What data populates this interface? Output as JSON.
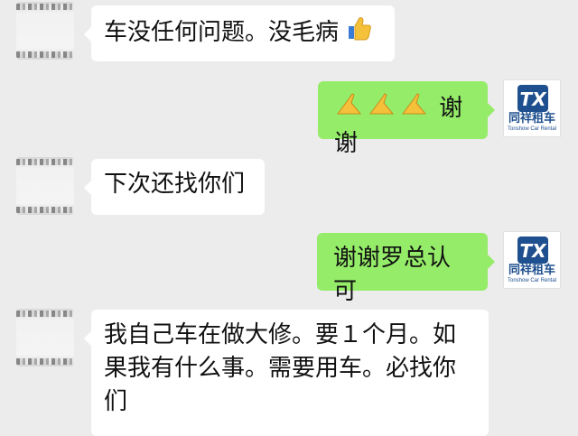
{
  "messages": [
    {
      "sender": "contact",
      "text": "车没任何问题。没毛病",
      "emoji": "thumbs-up"
    },
    {
      "sender": "me",
      "text": "谢谢",
      "emoji": "folded-hands-x3"
    },
    {
      "sender": "contact",
      "text": "下次还找你们"
    },
    {
      "sender": "me",
      "text": "谢谢罗总认可"
    },
    {
      "sender": "contact",
      "text": "我自己车在做大修。要１个月。如果我有什么事。需要用车。必找你们"
    }
  ],
  "my_avatar": {
    "logo_letters": "TX",
    "brand_name": "同祥租车",
    "brand_name_en": "Tonshow Car Rental"
  },
  "colors": {
    "background": "#ececec",
    "incoming_bubble": "#ffffff",
    "outgoing_bubble": "#95ec69",
    "brand": "#1e4f8e"
  }
}
